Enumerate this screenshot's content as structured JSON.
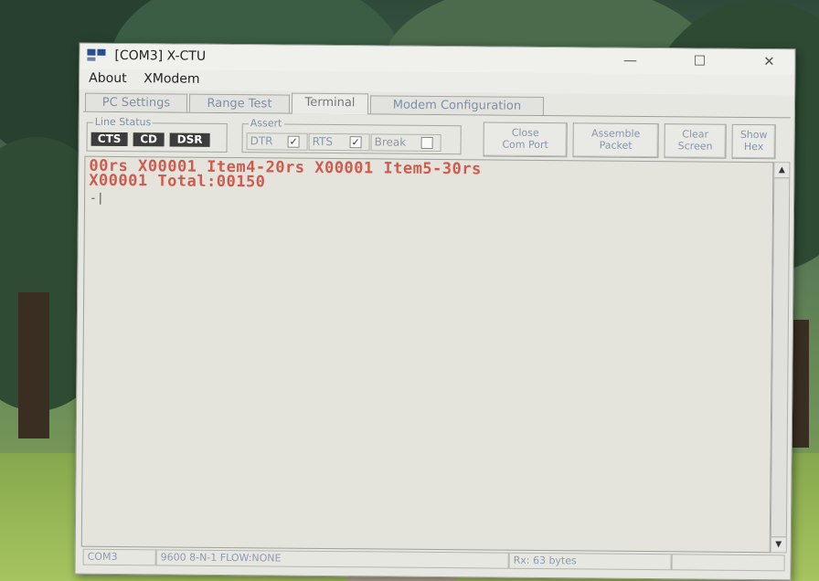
{
  "window": {
    "title": "[COM3] X-CTU",
    "controls": {
      "minimize": "—",
      "maximize": "☐",
      "close": "✕"
    }
  },
  "menu": {
    "items": [
      "About",
      "XModem"
    ]
  },
  "tabs": [
    {
      "label": "PC Settings",
      "active": false
    },
    {
      "label": "Range Test",
      "active": false
    },
    {
      "label": "Terminal",
      "active": true
    },
    {
      "label": "Modem Configuration",
      "active": false
    }
  ],
  "line_status": {
    "label": "Line Status",
    "indicators": [
      "CTS",
      "CD",
      "DSR"
    ]
  },
  "assert": {
    "label": "Assert",
    "items": [
      {
        "label": "DTR",
        "checked": true
      },
      {
        "label": "RTS",
        "checked": true
      },
      {
        "label": "Break",
        "checked": false
      }
    ]
  },
  "buttons": {
    "close_com_port": [
      "Close",
      "Com Port"
    ],
    "assemble_packet": [
      "Assemble",
      "Packet"
    ],
    "clear_screen": [
      "Clear",
      "Screen"
    ],
    "show_hex": [
      "Show",
      "Hex"
    ]
  },
  "terminal": {
    "lines": [
      "00rs X00001 Item4-20rs X00001 Item5-30rs",
      "X00001 Total:00150"
    ],
    "cursor": "-|",
    "text_color": "#cf5b4e"
  },
  "status_bar": {
    "port": "COM3",
    "settings": "9600 8-N-1  FLOW:NONE",
    "rx": "Rx: 63 bytes"
  }
}
